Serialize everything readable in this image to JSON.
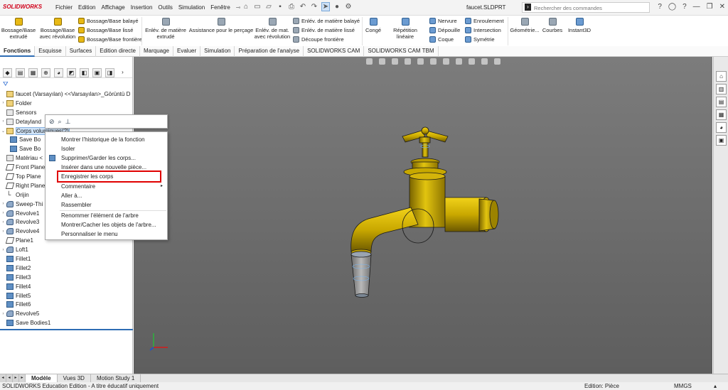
{
  "app": {
    "brand": "SOLIDWORKS",
    "title": "faucet.SLDPRT"
  },
  "menus": [
    "Fichier",
    "Edition",
    "Affichage",
    "Insertion",
    "Outils",
    "Simulation",
    "Fenêtre"
  ],
  "search": {
    "placeholder": "Rechercher des commandes"
  },
  "ribbon": {
    "bossage_extrude": "Bossage/Base extrudé",
    "bossage_revolution": "Bossage/Base avec révolution",
    "bossage_balaye": "Bossage/Base balayé",
    "bossage_lisse": "Bossage/Base lissé",
    "bossage_frontiere": "Bossage/Base frontière",
    "enlev_extrude": "Enlév. de matière extrudé",
    "assistance_percage": "Assistance pour le perçage",
    "enlev_revolution": "Enlév. de mat. avec révolution",
    "enlev_balaye": "Enlév. de matière balayé",
    "enlev_lisse": "Enlév. de matière lissé",
    "decoupe_frontiere": "Découpe frontière",
    "conge": "Congé",
    "repetition_lineaire": "Répétition linéaire",
    "nervure": "Nervure",
    "depouille": "Dépouille",
    "coque": "Coque",
    "enroulement": "Enroulement",
    "intersection": "Intersection",
    "symetrie": "Symétrie",
    "geometrie": "Géométrie...",
    "courbes": "Courbes",
    "instant3d": "Instant3D"
  },
  "tabs": [
    "Fonctions",
    "Esquisse",
    "Surfaces",
    "Edition directe",
    "Marquage",
    "Evaluer",
    "Simulation",
    "Préparation de l'analyse",
    "SOLIDWORKS CAM",
    "SOLIDWORKS CAM TBM"
  ],
  "tree": [
    {
      "label": "faucet (Varsayılan) <<Varsayılan>_Görüntü D",
      "icon": "part"
    },
    {
      "label": "Folder",
      "icon": "fold"
    },
    {
      "label": "Sensors",
      "icon": "sens"
    },
    {
      "label": "Detayland",
      "icon": "anno"
    },
    {
      "label": "Corps volumiques(2)",
      "icon": "fold"
    },
    {
      "label": "Save Bo",
      "icon": "body"
    },
    {
      "label": "Save Bo",
      "icon": "body"
    },
    {
      "label": "Matériau <",
      "icon": "mat"
    },
    {
      "label": "Front Plane",
      "icon": "plane"
    },
    {
      "label": "Top Plane",
      "icon": "plane"
    },
    {
      "label": "Right Plane",
      "icon": "plane"
    },
    {
      "label": "Orijin",
      "icon": "origin"
    },
    {
      "label": "Sweep-Thi",
      "icon": "rev"
    },
    {
      "label": "Revolve1",
      "icon": "rev"
    },
    {
      "label": "Revolve3",
      "icon": "rev"
    },
    {
      "label": "Revolve4",
      "icon": "rev"
    },
    {
      "label": "Plane1",
      "icon": "plane"
    },
    {
      "label": "Loft1",
      "icon": "rev"
    },
    {
      "label": "Fillet1",
      "icon": "body"
    },
    {
      "label": "Fillet2",
      "icon": "body"
    },
    {
      "label": "Fillet3",
      "icon": "body"
    },
    {
      "label": "Fillet4",
      "icon": "body"
    },
    {
      "label": "Fillet5",
      "icon": "body"
    },
    {
      "label": "Fillet6",
      "icon": "body"
    },
    {
      "label": "Revolve5",
      "icon": "rev"
    },
    {
      "label": "Save Bodies1",
      "icon": "body"
    }
  ],
  "context_menu": [
    "Montrer l'historique de la fonction",
    "Isoler",
    "Supprimer/Garder les corps...",
    "Insérer dans une nouvelle pièce...",
    "Enregistrer les corps",
    "Commentaire",
    "Aller à...",
    "Rassembler",
    "Renommer l'élément de l'arbre",
    "Montrer/Cacher les objets de l'arbre...",
    "Personnaliser le menu"
  ],
  "bottom_tabs": [
    "Modèle",
    "Vues 3D",
    "Motion Study 1"
  ],
  "status": {
    "left": "SOLIDWORKS Education Edition - A titre éducatif uniquement",
    "edition": "Edition: Pièce",
    "units": "MMGS"
  },
  "colors": {
    "accent": "#2e6db4",
    "highlight": "#e00000",
    "model": "#d9b400"
  }
}
